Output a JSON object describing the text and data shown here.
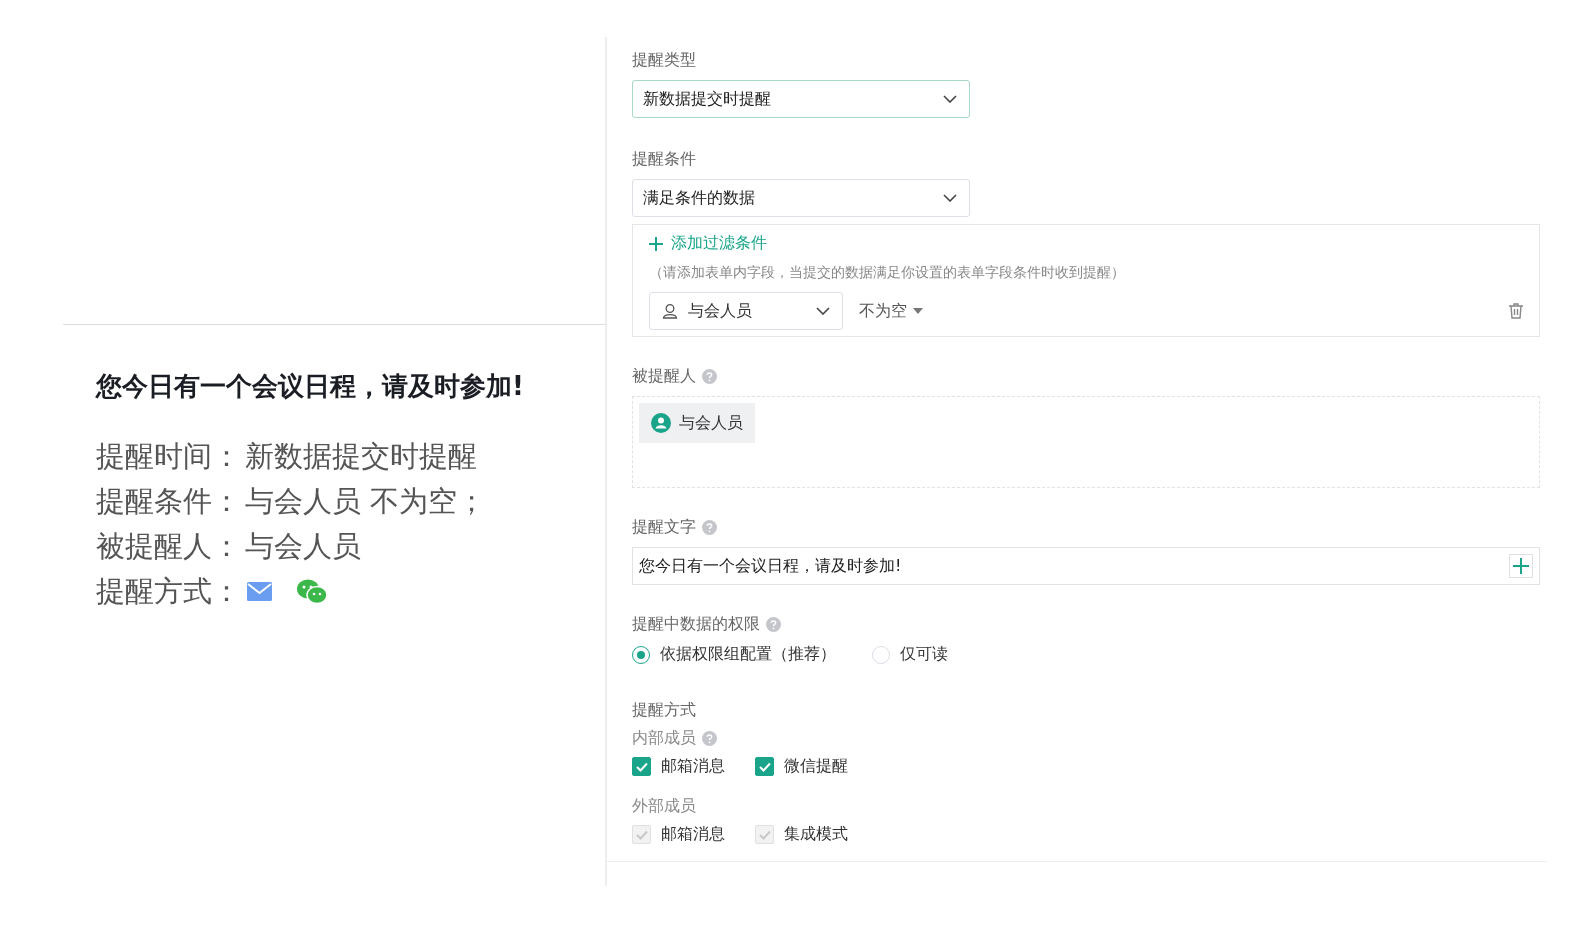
{
  "preview": {
    "title": "您今日有一个会议日程，请及时参加!",
    "lines": [
      {
        "kind": "text",
        "label": "提醒时间：",
        "value": "新数据提交时提醒"
      },
      {
        "kind": "text",
        "label": "提醒条件：",
        "value": "与会人员 不为空；"
      },
      {
        "kind": "text",
        "label": "被提醒人：",
        "value": "与会人员"
      },
      {
        "kind": "icons",
        "label": "提醒方式："
      }
    ]
  },
  "form": {
    "reminder_type": {
      "label": "提醒类型",
      "value": "新数据提交时提醒"
    },
    "condition": {
      "label": "提醒条件",
      "value": "满足条件的数据",
      "add_filter": "添加过滤条件",
      "hint": "（请添加表单内字段，当提交的数据满足你设置的表单字段条件时收到提醒）",
      "filter": {
        "field": "与会人员",
        "operator": "不为空"
      }
    },
    "recipients": {
      "label": "被提醒人",
      "help": true,
      "tags": [
        "与会人员"
      ]
    },
    "text": {
      "label": "提醒文字",
      "help": true,
      "value": "您今日有一个会议日程，请及时参加!"
    },
    "permission": {
      "label": "提醒中数据的权限",
      "help": true,
      "options": [
        {
          "label": "依据权限组配置（推荐）",
          "selected": true
        },
        {
          "label": "仅可读",
          "selected": false
        }
      ]
    },
    "methods": {
      "label": "提醒方式",
      "groups": [
        {
          "label": "内部成员",
          "help": true,
          "options": [
            {
              "label": "邮箱消息",
              "checked": true,
              "disabled": false
            },
            {
              "label": "微信提醒",
              "checked": true,
              "disabled": false
            }
          ]
        },
        {
          "label": "外部成员",
          "help": false,
          "options": [
            {
              "label": "邮箱消息",
              "checked": true,
              "disabled": true
            },
            {
              "label": "集成模式",
              "checked": true,
              "disabled": true
            }
          ]
        }
      ]
    }
  }
}
